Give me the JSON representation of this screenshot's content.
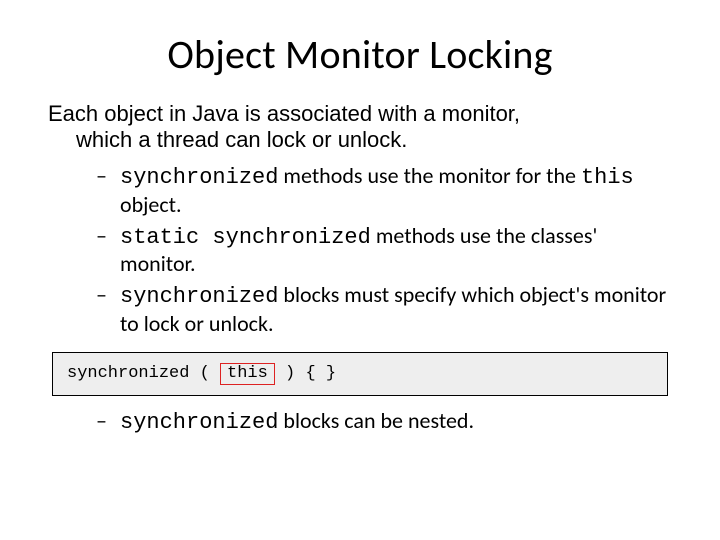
{
  "title": "Object Monitor Locking",
  "intro": {
    "line1": "Each object in Java is associated with a monitor,",
    "line2": "which a thread can lock or unlock."
  },
  "bullets": {
    "b1": {
      "kw": "synchronized",
      "rest1": " methods use the monitor for the ",
      "kw2": "this",
      "rest2": " object."
    },
    "b2": {
      "kw": "static synchronized",
      "rest": " methods use the classes' monitor."
    },
    "b3": {
      "kw": "synchronized",
      "rest": " blocks must specify which object's monitor to lock or unlock."
    },
    "b4": {
      "kw": "synchronized",
      "rest": " blocks can be nested."
    }
  },
  "code": {
    "pre": "synchronized ( ",
    "highlight": "this",
    "post": " ) { }"
  }
}
